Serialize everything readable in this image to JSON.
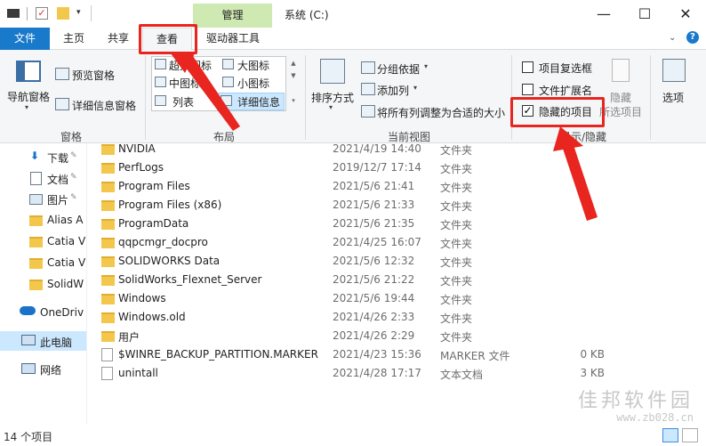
{
  "window": {
    "context_tab": "管理",
    "title": "系统 (C:)",
    "minimize": "—",
    "maximize": "☐",
    "close": "✕"
  },
  "tabs": {
    "file": "文件",
    "home": "主页",
    "share": "共享",
    "view": "查看",
    "drive_tools": "驱动器工具"
  },
  "ribbon": {
    "panes": {
      "nav_pane": "导航窗格",
      "preview_pane": "预览窗格",
      "details_pane": "详细信息窗格",
      "label": "窗格"
    },
    "layout": {
      "xl_icons": "超大图标",
      "l_icons": "大图标",
      "m_icons": "中图标",
      "s_icons": "小图标",
      "list": "列表",
      "details": "详细信息",
      "label": "布局"
    },
    "current_view": {
      "sort_by": "排序方式",
      "group_by": "分组依据",
      "add_column": "添加列",
      "fit_columns": "将所有列调整为合适的大小",
      "label": "当前视图"
    },
    "show_hide": {
      "item_checkboxes": "项目复选框",
      "file_extensions": "文件扩展名",
      "hidden_items": "隐藏的项目",
      "hide_selected": "隐藏",
      "hide_selected_2": "所选项目",
      "label": "显示/隐藏"
    },
    "options": "选项"
  },
  "nav": {
    "items": [
      {
        "label": "下载"
      },
      {
        "label": "文档"
      },
      {
        "label": "图片"
      },
      {
        "label": "Alias A"
      },
      {
        "label": "Catia V"
      },
      {
        "label": "Catia V"
      },
      {
        "label": "SolidW"
      },
      {
        "label": "OneDriv"
      },
      {
        "label": "此电脑"
      },
      {
        "label": "网络"
      }
    ]
  },
  "files": [
    {
      "name": "NVIDIA",
      "date": "2021/4/19 14:40",
      "type": "文件夹",
      "size": ""
    },
    {
      "name": "PerfLogs",
      "date": "2019/12/7 17:14",
      "type": "文件夹",
      "size": ""
    },
    {
      "name": "Program Files",
      "date": "2021/5/6 21:41",
      "type": "文件夹",
      "size": ""
    },
    {
      "name": "Program Files (x86)",
      "date": "2021/5/6 21:33",
      "type": "文件夹",
      "size": ""
    },
    {
      "name": "ProgramData",
      "date": "2021/5/6 21:35",
      "type": "文件夹",
      "size": ""
    },
    {
      "name": "qqpcmgr_docpro",
      "date": "2021/4/25 16:07",
      "type": "文件夹",
      "size": ""
    },
    {
      "name": "SOLIDWORKS Data",
      "date": "2021/5/6 12:32",
      "type": "文件夹",
      "size": ""
    },
    {
      "name": "SolidWorks_Flexnet_Server",
      "date": "2021/5/6 21:22",
      "type": "文件夹",
      "size": ""
    },
    {
      "name": "Windows",
      "date": "2021/5/6 19:44",
      "type": "文件夹",
      "size": ""
    },
    {
      "name": "Windows.old",
      "date": "2021/4/26 2:33",
      "type": "文件夹",
      "size": ""
    },
    {
      "name": "用户",
      "date": "2021/4/26 2:29",
      "type": "文件夹",
      "size": ""
    },
    {
      "name": "$WINRE_BACKUP_PARTITION.MARKER",
      "date": "2021/4/23 15:36",
      "type": "MARKER 文件",
      "size": "0 KB"
    },
    {
      "name": "unintall",
      "date": "2021/4/28 17:17",
      "type": "文本文档",
      "size": "3 KB"
    }
  ],
  "status": {
    "count": "14 个项目"
  },
  "watermark": {
    "text": "佳邦软件园",
    "url": "www.zb028.cn"
  },
  "colors": {
    "accent": "#1979ca",
    "highlight": "#e8251f",
    "context_tab": "#cfe9b3"
  }
}
